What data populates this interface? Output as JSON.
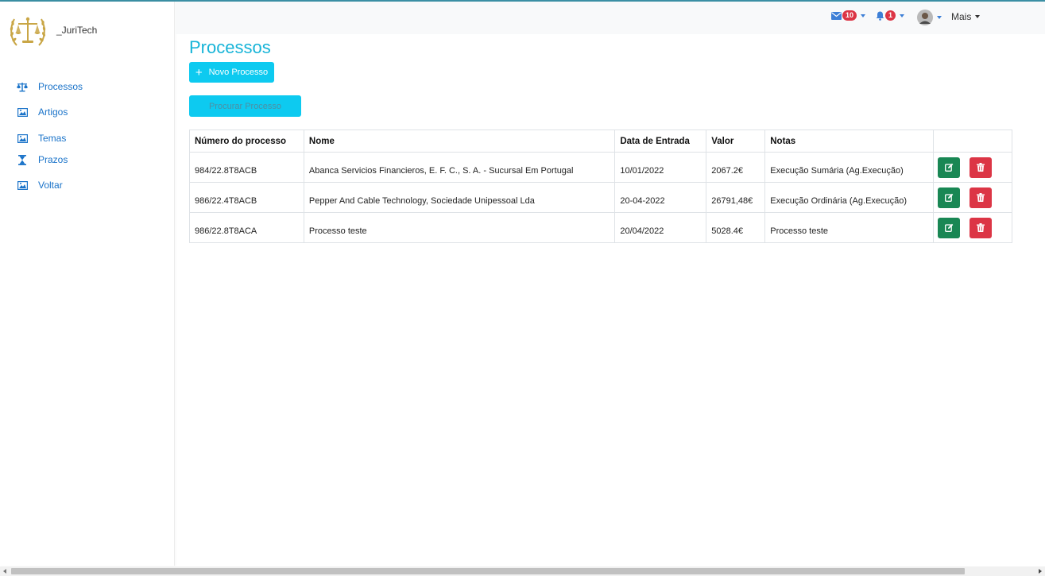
{
  "brand": {
    "name": "_JuriTech"
  },
  "sidebar": {
    "items": [
      {
        "label": "Processos",
        "icon": "scale-icon"
      },
      {
        "label": "Artigos",
        "icon": "image-icon"
      },
      {
        "label": "Temas",
        "icon": "image-icon"
      },
      {
        "label": "Prazos",
        "icon": "hourglass-icon"
      },
      {
        "label": "Voltar",
        "icon": "image-icon"
      }
    ]
  },
  "topbar": {
    "messages_count": "10",
    "alerts_count": "1",
    "more_label": "Mais"
  },
  "page": {
    "title": "Processos",
    "new_button": "Novo Processo",
    "search_button": "Procurar Processo"
  },
  "table": {
    "headers": [
      "Número do processo",
      "Nome",
      "Data de Entrada",
      "Valor",
      "Notas",
      ""
    ],
    "rows": [
      [
        "984/22.8T8ACB",
        "Abanca Servicios Financieros, E. F. C., S. A. - Sucursal Em Portugal",
        "10/01/2022",
        "2067.2€",
        "Execução Sumária (Ag.Execução)"
      ],
      [
        "986/22.4T8ACB",
        "Pepper And Cable Technology, Sociedade Unipessoal Lda",
        "20-04-2022",
        "26791,48€",
        "Execução Ordinária (Ag.Execução)"
      ],
      [
        "986/22.8T8ACA",
        "Processo teste",
        "20/04/2022",
        "5028.4€",
        "Processo teste"
      ]
    ]
  },
  "colors": {
    "accent": "#0dcaf0",
    "title": "#17b4d8",
    "link": "#1a73c9",
    "edit": "#198754",
    "delete": "#dc3545",
    "logo_gold": "#c9a646"
  }
}
